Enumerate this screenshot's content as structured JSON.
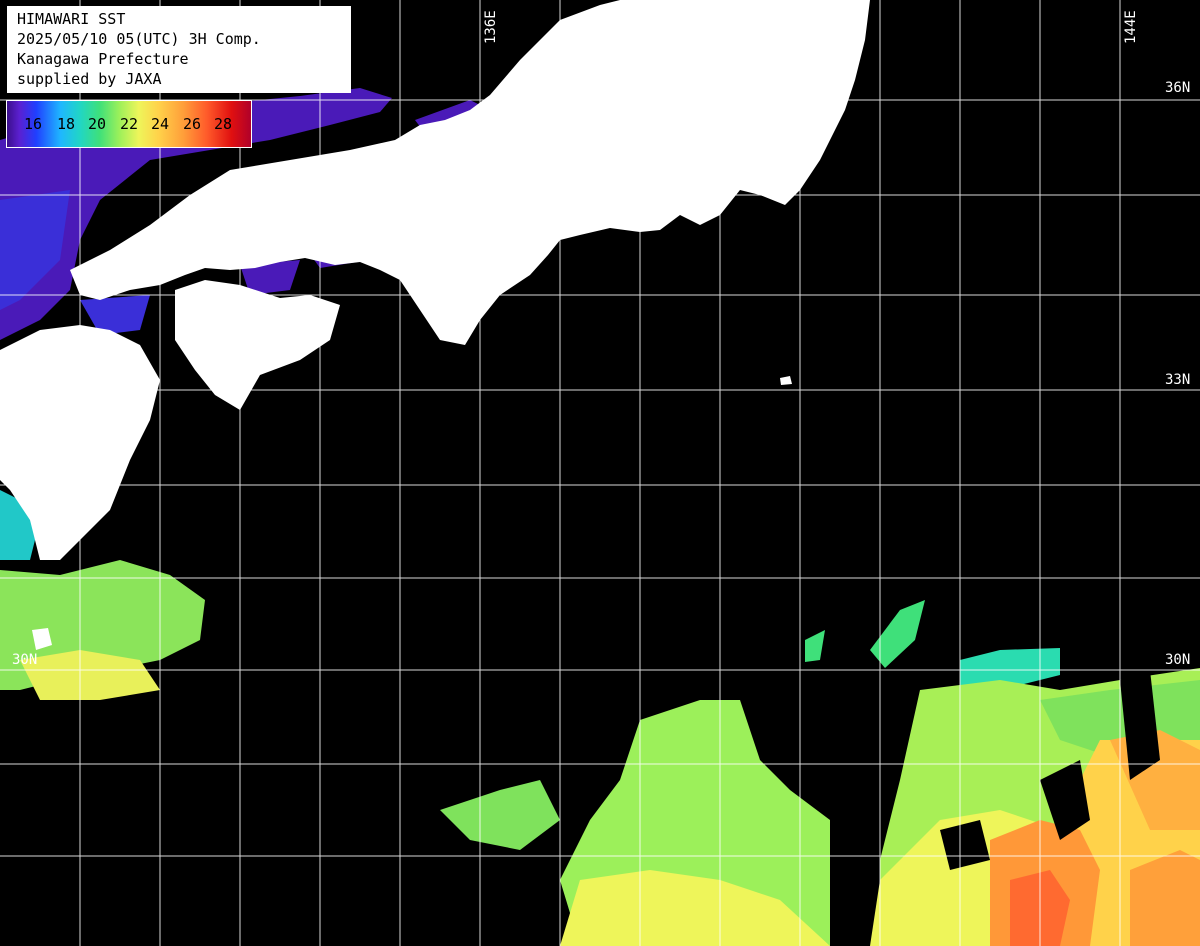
{
  "header": {
    "line1": "HIMAWARI SST",
    "line2": "2025/05/10 05(UTC) 3H Comp.",
    "line3": "Kanagawa Prefecture",
    "line4": "supplied by JAXA"
  },
  "legend": {
    "ticks": [
      "16",
      "18",
      "20",
      "22",
      "24",
      "26",
      "28"
    ],
    "colors": {
      "16": "#5a1fd0",
      "18": "#1fb7ff",
      "20": "#3fe07a",
      "22": "#eef55a",
      "24": "#ffd24a",
      "26": "#ff5a2a",
      "28": "#c0001c"
    }
  },
  "grid_labels": {
    "lon_136": "136E",
    "lon_144": "144E",
    "lat_36": "36N",
    "lat_33": "33N",
    "lat_30_left": "30N",
    "lat_30_right": "30N"
  },
  "colors": {
    "land": "#ffffff",
    "no_data": "#000000",
    "grid": "#ffffff"
  }
}
